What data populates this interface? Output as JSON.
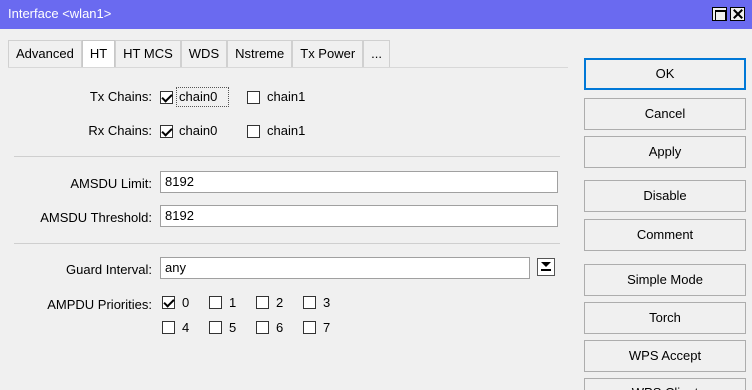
{
  "window": {
    "title": "Interface <wlan1>"
  },
  "tabs": [
    "Advanced",
    "HT",
    "HT MCS",
    "WDS",
    "Nstreme",
    "Tx Power",
    "..."
  ],
  "form": {
    "tx_chains": {
      "label": "Tx Chains:",
      "options": [
        {
          "label": "chain0",
          "checked": true
        },
        {
          "label": "chain1",
          "checked": false
        }
      ]
    },
    "rx_chains": {
      "label": "Rx Chains:",
      "options": [
        {
          "label": "chain0",
          "checked": true
        },
        {
          "label": "chain1",
          "checked": false
        }
      ]
    },
    "amsdu_limit": {
      "label": "AMSDU Limit:",
      "value": "8192"
    },
    "amsdu_threshold": {
      "label": "AMSDU Threshold:",
      "value": "8192"
    },
    "guard_interval": {
      "label": "Guard Interval:",
      "value": "any"
    },
    "ampdu_priorities": {
      "label": "AMPDU Priorities:",
      "options": [
        {
          "label": "0",
          "checked": true
        },
        {
          "label": "1",
          "checked": false
        },
        {
          "label": "2",
          "checked": false
        },
        {
          "label": "3",
          "checked": false
        },
        {
          "label": "4",
          "checked": false
        },
        {
          "label": "5",
          "checked": false
        },
        {
          "label": "6",
          "checked": false
        },
        {
          "label": "7",
          "checked": false
        }
      ]
    }
  },
  "buttons": [
    "OK",
    "Cancel",
    "Apply",
    "Disable",
    "Comment",
    "Simple Mode",
    "Torch",
    "WPS Accept",
    "WPS Client"
  ]
}
